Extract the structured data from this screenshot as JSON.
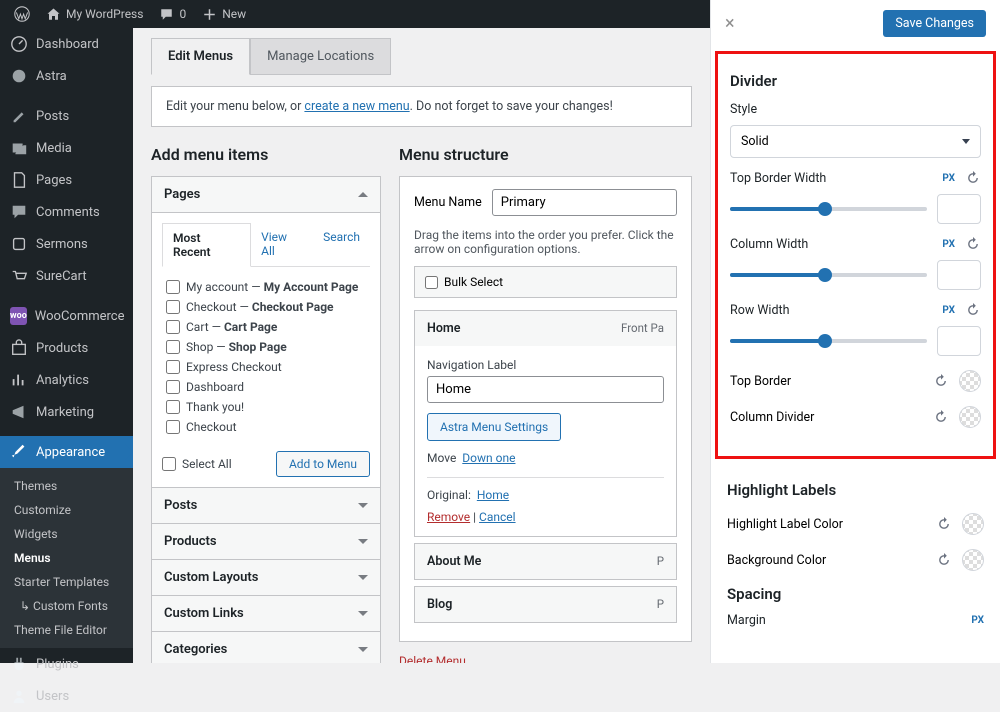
{
  "topbar": {
    "site": "My WordPress",
    "comments": "0",
    "new": "New"
  },
  "sidebar": {
    "primary": [
      "Dashboard",
      "Astra",
      "Posts",
      "Media",
      "Pages",
      "Comments",
      "Sermons",
      "SureCart",
      "WooCommerce",
      "Products",
      "Analytics",
      "Marketing",
      "Appearance"
    ],
    "sub": [
      "Themes",
      "Customize",
      "Widgets",
      "Menus",
      "Starter Templates",
      "Custom Fonts",
      "Theme File Editor"
    ],
    "rest": [
      "Plugins",
      "Users"
    ]
  },
  "tabs": {
    "edit": "Edit Menus",
    "manage": "Manage Locations"
  },
  "notice": {
    "pre": "Edit your menu below, or ",
    "link": "create a new menu",
    "post": ". Do not forget to save your changes!"
  },
  "addheader": "Add menu items",
  "structheader": "Menu structure",
  "pagesbox": {
    "title": "Pages",
    "tabs": [
      "Most Recent",
      "View All",
      "Search"
    ],
    "items": [
      {
        "l": "My account — ",
        "s": "My Account Page"
      },
      {
        "l": "Checkout — ",
        "s": "Checkout Page"
      },
      {
        "l": "Cart — ",
        "s": "Cart Page"
      },
      {
        "l": "Shop — ",
        "s": "Shop Page"
      },
      {
        "l": "Express Checkout",
        "s": ""
      },
      {
        "l": "Dashboard",
        "s": ""
      },
      {
        "l": "Thank you!",
        "s": ""
      },
      {
        "l": "Checkout",
        "s": ""
      }
    ],
    "selectall": "Select All",
    "add": "Add to Menu"
  },
  "accordions": [
    "Posts",
    "Products",
    "Custom Layouts",
    "Custom Links",
    "Categories"
  ],
  "menuname": {
    "label": "Menu Name",
    "value": "Primary"
  },
  "instr": "Drag the items into the order you prefer. Click the arrow on configuration options.",
  "bulk": "Bulk Select",
  "m1": {
    "title": "Home",
    "type": "Front Pa",
    "navlabel": "Navigation Label",
    "navvalue": "Home",
    "astra": "Astra Menu Settings",
    "move": "Move",
    "down": "Down one",
    "orig": "Original:",
    "origlink": "Home",
    "remove": "Remove",
    "cancel": "Cancel"
  },
  "m2": {
    "title": "About Me",
    "type": "P"
  },
  "m3": {
    "title": "Blog",
    "type": "P"
  },
  "delete": "Delete Menu",
  "panel": {
    "save": "Save Changes",
    "divider": "Divider",
    "style": "Style",
    "solid": "Solid",
    "tbw": "Top Border Width",
    "cw": "Column Width",
    "rw": "Row Width",
    "px": "PX",
    "tb": "Top Border",
    "cd": "Column Divider",
    "hl": "Highlight Labels",
    "hlc": "Highlight Label Color",
    "bgc": "Background Color",
    "spacing": "Spacing",
    "margin": "Margin"
  }
}
